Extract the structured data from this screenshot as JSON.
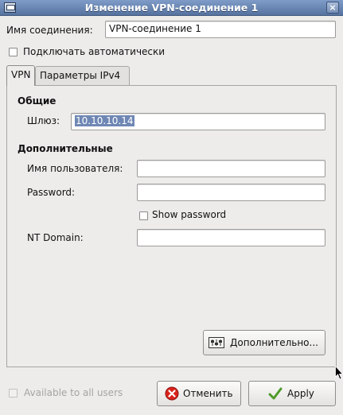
{
  "window": {
    "title": "Изменение VPN-соединение 1",
    "icon": "network-app-icon",
    "close_icon": "×"
  },
  "connection": {
    "name_label": "Имя соединения:",
    "name_value": "VPN-соединение 1",
    "autoconnect_label": "Подключать автоматически",
    "autoconnect_checked": false
  },
  "tabs": [
    {
      "label": "VPN",
      "active": true
    },
    {
      "label": "Параметры IPv4",
      "active": false
    }
  ],
  "vpn": {
    "general_title": "Общие",
    "gateway_label": "Шлюз:",
    "gateway_value": "10.10.10.14",
    "optional_title": "Дополнительные",
    "username_label": "Имя пользователя:",
    "username_value": "",
    "password_label": "Password:",
    "password_value": "",
    "show_password_label": "Show password",
    "show_password_checked": false,
    "nt_domain_label": "NT Domain:",
    "nt_domain_value": "",
    "advanced_button": "Дополнительно...",
    "advanced_icon": "advanced-settings-icon"
  },
  "footer": {
    "available_all_users_label": "Available to all users",
    "available_all_users_checked": false,
    "cancel_button": "Отменить",
    "cancel_icon": "cancel-x-icon",
    "apply_button": "Apply",
    "apply_icon": "check-icon"
  },
  "colors": {
    "titlebar": "#6a88b6",
    "selection": "#6f87b4",
    "cancel_icon": "#d9231c",
    "apply_icon": "#4f9b2b"
  }
}
